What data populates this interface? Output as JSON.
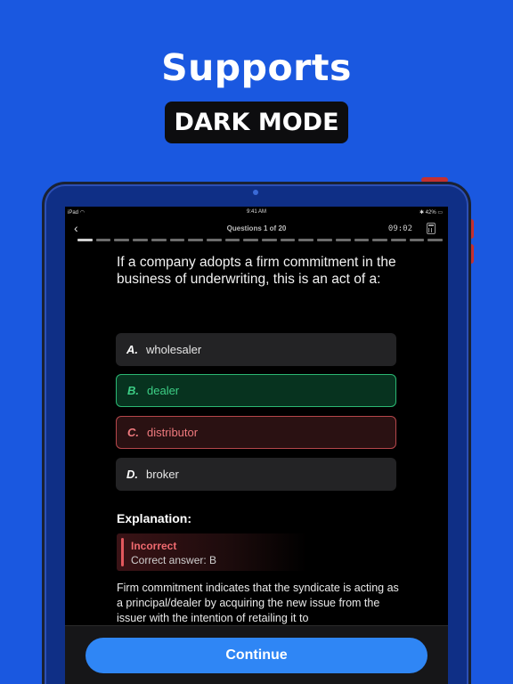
{
  "promo": {
    "headline": "Supports",
    "badge": "DARK MODE"
  },
  "status_bar": {
    "device": "iPad",
    "time": "9:41 AM",
    "battery": "42%"
  },
  "nav": {
    "title": "Questions 1 of 20",
    "timer": "09:02",
    "progress_total": 20,
    "progress_done": 1
  },
  "question": {
    "text": "If a company adopts a firm commitment in the business of underwriting, this is an act of a:"
  },
  "options": [
    {
      "letter": "A.",
      "text": "wholesaler",
      "state": "neutral"
    },
    {
      "letter": "B.",
      "text": "dealer",
      "state": "correct"
    },
    {
      "letter": "C.",
      "text": "distributor",
      "state": "incorrect"
    },
    {
      "letter": "D.",
      "text": "broker",
      "state": "neutral"
    }
  ],
  "explanation": {
    "title": "Explanation:",
    "result_label": "Incorrect",
    "correct_answer": "Correct answer: B",
    "body": "Firm commitment indicates that the syndicate is acting as a principal/dealer by acquiring the new issue from the issuer with the intention of retailing it to"
  },
  "footer": {
    "continue_label": "Continue"
  },
  "colors": {
    "background": "#1a58e0",
    "correct": "#3dcf86",
    "incorrect": "#f07a7e",
    "button": "#2f86f5"
  }
}
